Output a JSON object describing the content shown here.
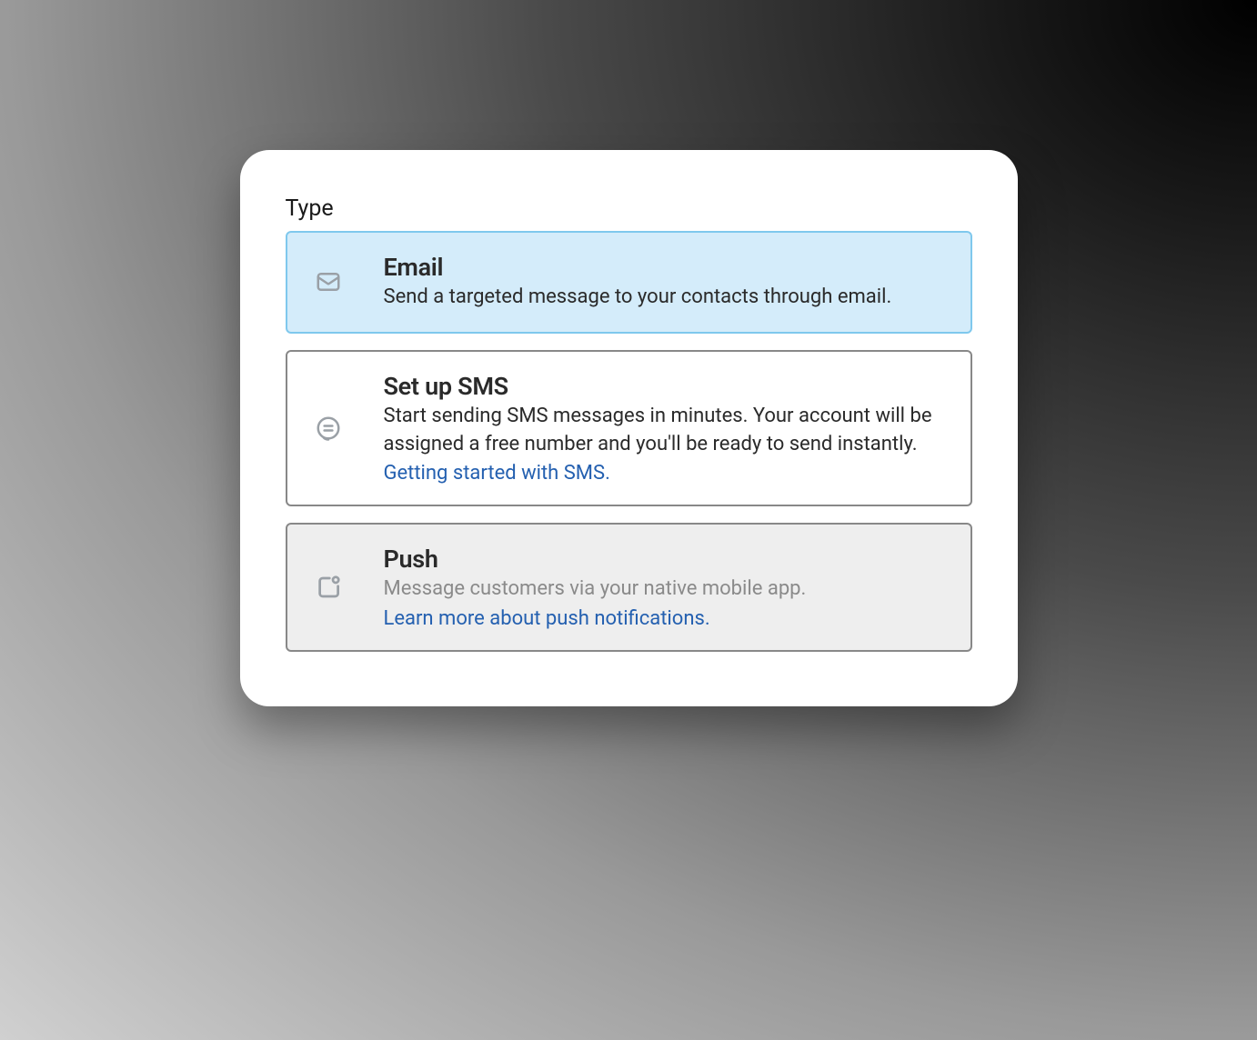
{
  "section_label": "Type",
  "options": {
    "email": {
      "title": "Email",
      "description": "Send a targeted message to your contacts through email."
    },
    "sms": {
      "title": "Set up SMS",
      "description": "Start sending SMS messages in minutes. Your account will be assigned a free number and you'll be ready to send instantly.",
      "link": "Getting started with SMS."
    },
    "push": {
      "title": "Push",
      "description": "Message customers via your native mobile app.",
      "link": "Learn more about push notifications."
    }
  }
}
